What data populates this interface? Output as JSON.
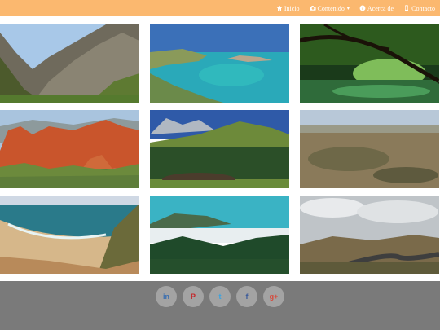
{
  "navbar": {
    "items": [
      {
        "label": "Inicio",
        "icon": "home-icon"
      },
      {
        "label": "Contenido",
        "icon": "camera-icon",
        "has_dropdown": true
      },
      {
        "label": "Acerca de",
        "icon": "info-icon"
      },
      {
        "label": "Contacto",
        "icon": "phone-icon"
      }
    ],
    "background": "#fbb86f"
  },
  "gallery": {
    "photos": [
      {
        "subject": "rocky hillside with trees"
      },
      {
        "subject": "turquoise bay with boats"
      },
      {
        "subject": "tree over green river"
      },
      {
        "subject": "red rock formations"
      },
      {
        "subject": "mountain valley with pine forest"
      },
      {
        "subject": "dry plateau landscape"
      },
      {
        "subject": "beach bay with waves"
      },
      {
        "subject": "mountains above sea of clouds"
      },
      {
        "subject": "winding mountain road under clouds"
      }
    ]
  },
  "footer": {
    "background": "#7a7a7a",
    "social": [
      {
        "icon": "linkedin-icon",
        "glyph": "in",
        "color": "#3b6fb0"
      },
      {
        "icon": "pinterest-icon",
        "glyph": "P",
        "color": "#c4272b"
      },
      {
        "icon": "twitter-icon",
        "glyph": "t",
        "color": "#3ba3e0"
      },
      {
        "icon": "facebook-icon",
        "glyph": "f",
        "color": "#3b5a9a"
      },
      {
        "icon": "google-plus-icon",
        "glyph": "g+",
        "color": "#d6493b"
      }
    ]
  }
}
